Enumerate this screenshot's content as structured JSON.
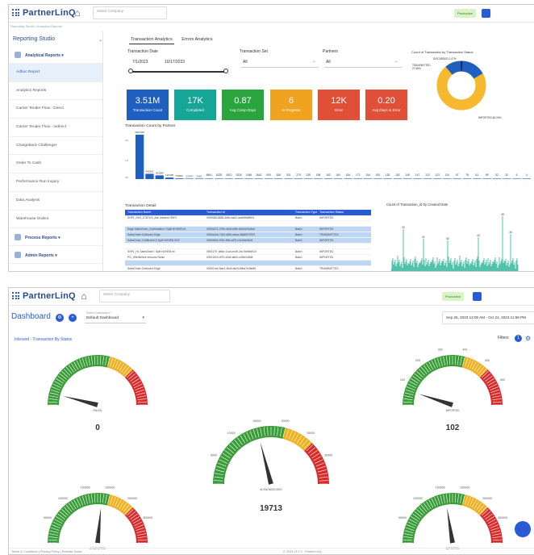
{
  "app": {
    "logo": "PartnerLinQ",
    "company_placeholder": "Select Company",
    "env": "Production"
  },
  "top": {
    "breadcrumb": "Reporting Studio / Analytics Reports",
    "sidebar": {
      "title": "Reporting Studio",
      "group1": "Analytical Reports",
      "items": [
        "Adhoc Report",
        "Analytics Reports",
        "Carrier Tender Flow - Direct",
        "Carrier Tender Flow - Indirect",
        "Chargeback Challenger",
        "Order To Cash",
        "Performance Run Inquiry",
        "Data Analysis",
        "Warehouse Orders"
      ],
      "group2": "Process Reports",
      "group3": "Admin Reports"
    },
    "tabs": [
      "Transaction Analytics",
      "Errors Analytics"
    ],
    "filters": {
      "date_label": "Transaction Date",
      "date_from": "7/1/2023",
      "date_to": "10/17/2023",
      "set_label": "Transaction Set",
      "set_value": "All",
      "partners_label": "Partners",
      "partners_value": "All"
    },
    "kpis": [
      {
        "value": "3.51M",
        "label": "Transaction Count",
        "color": "#1f5fbf"
      },
      {
        "value": "17K",
        "label": "Completed",
        "color": "#17a598"
      },
      {
        "value": "0.87",
        "label": "Avg Comp Days",
        "color": "#2aa53e"
      },
      {
        "value": "6",
        "label": "In Progress",
        "color": "#f0a320"
      },
      {
        "value": "12K",
        "label": "Error",
        "color": "#e05038"
      },
      {
        "value": "0.20",
        "label": "Avg Days in Error",
        "color": "#e05038"
      }
    ],
    "status_title": "Count of Transaction by Transaction Status",
    "status_labels": [
      "DISCARDED 1.07%",
      "TRANSMITTED 27.66%",
      "IMPORTED 60.00%"
    ],
    "bar_title": "Transaction Count by Partner",
    "bar_labels": [
      "3607945",
      "430301",
      "302586",
      "122436",
      "53289",
      "27074",
      "9162",
      "6961",
      "6225",
      "4512",
      "3330",
      "1946",
      "1642",
      "900",
      "626",
      "301",
      "275",
      "235",
      "198",
      "163",
      "160",
      "154",
      "171",
      "154",
      "153",
      "152",
      "152",
      "149",
      "147",
      "123",
      "123",
      "110",
      "97",
      "78",
      "61",
      "59",
      "52",
      "32",
      "6",
      "4"
    ],
    "table_title": "Transaction Detail",
    "table_headers": [
      "Transaction Name",
      "Transaction Id",
      "Transaction Type",
      "Transaction Status"
    ],
    "table_rows": [
      [
        "SHP1_DKS_STATUS_Ash Inbound SHP1",
        "0000068-8883-468c-ba02-acdb8fa8f904",
        "Batch",
        "IMPORTED"
      ],
      [
        "",
        "",
        "",
        ""
      ],
      [
        "Edge SalesOrder_Confirmation / Split  NOHEB Int",
        "0000d471-275e-46c5-b5fe-64e2a3445c6",
        "Batch",
        "IMPORTED"
      ],
      [
        "SalesOrder Outbound Edge",
        "0000d4e6-73c0-a50b-a5da-38a59f7f37f4",
        "Batch",
        "TRANSMITTED"
      ],
      [
        "SalesOrder_Fulfillment O Split NOHEB OUT",
        "00002662-f760-4f5e-af79-c3c2d6ef1d6",
        "Batch",
        "IMPORTED"
      ],
      [
        "",
        "",
        "",
        ""
      ],
      [
        "SHP1_HL SalesOrder / Split NOHEB Int",
        "000017f7-db6e-41ce-be49-2ec76e8e6910",
        "Batch",
        "IMPORTED"
      ],
      [
        "PO_OfferBefore Inbound Swiss",
        "00001510-4f70-40a9-a8e9-c4f3e04848",
        "Batch",
        "IMPORTED"
      ],
      [
        "",
        "",
        "",
        ""
      ],
      [
        "SalesOrder Outbound Edge",
        "000001ee-5ae3-4640-a6c5-89ba7e36d98",
        "Batch",
        "TRANSMITTED"
      ]
    ],
    "area_title": "Count of Transaction_Id by Created Date",
    "area_peaks": [
      "20",
      "31",
      "50",
      "44",
      "49",
      "30"
    ]
  },
  "bottom": {
    "title": "Dashboard",
    "dash_select_label": "Select Dashboard *",
    "dash_select_value": "Default Dashboard",
    "date_range": "Sep 25, 2023 12:00 AM - Oct 24, 2023 11:59 PM",
    "subtitle": "Inbound - Transaction By Status",
    "filters_label": "Filters",
    "filters_count": "1",
    "gauges": [
      {
        "label": "FAILED",
        "value": "0",
        "ticks": []
      },
      {
        "label": "IMPORTED",
        "value": "102",
        "ticks": [
          "100",
          "200",
          "300",
          "400",
          "500",
          "600"
        ]
      },
      {
        "label": "ACKNOWLEDGED",
        "value": "19713",
        "ticks": [
          "5000",
          "10000",
          "15000",
          "20000",
          "25000",
          "30000"
        ]
      },
      {
        "label": "COMPLETED",
        "value": "",
        "ticks": [
          "50000",
          "100000",
          "150000",
          "200000",
          "250000",
          "300000"
        ]
      },
      {
        "label": "IMPORTED",
        "value": "",
        "ticks": [
          "50000",
          "100000",
          "150000",
          "200000",
          "250000",
          "300000"
        ]
      }
    ],
    "footer": "Terms & Conditions  |  Privacy Policy  |  Release Notes",
    "copyright": "© 2023 v3.7.0 · PartnerLinQ"
  }
}
